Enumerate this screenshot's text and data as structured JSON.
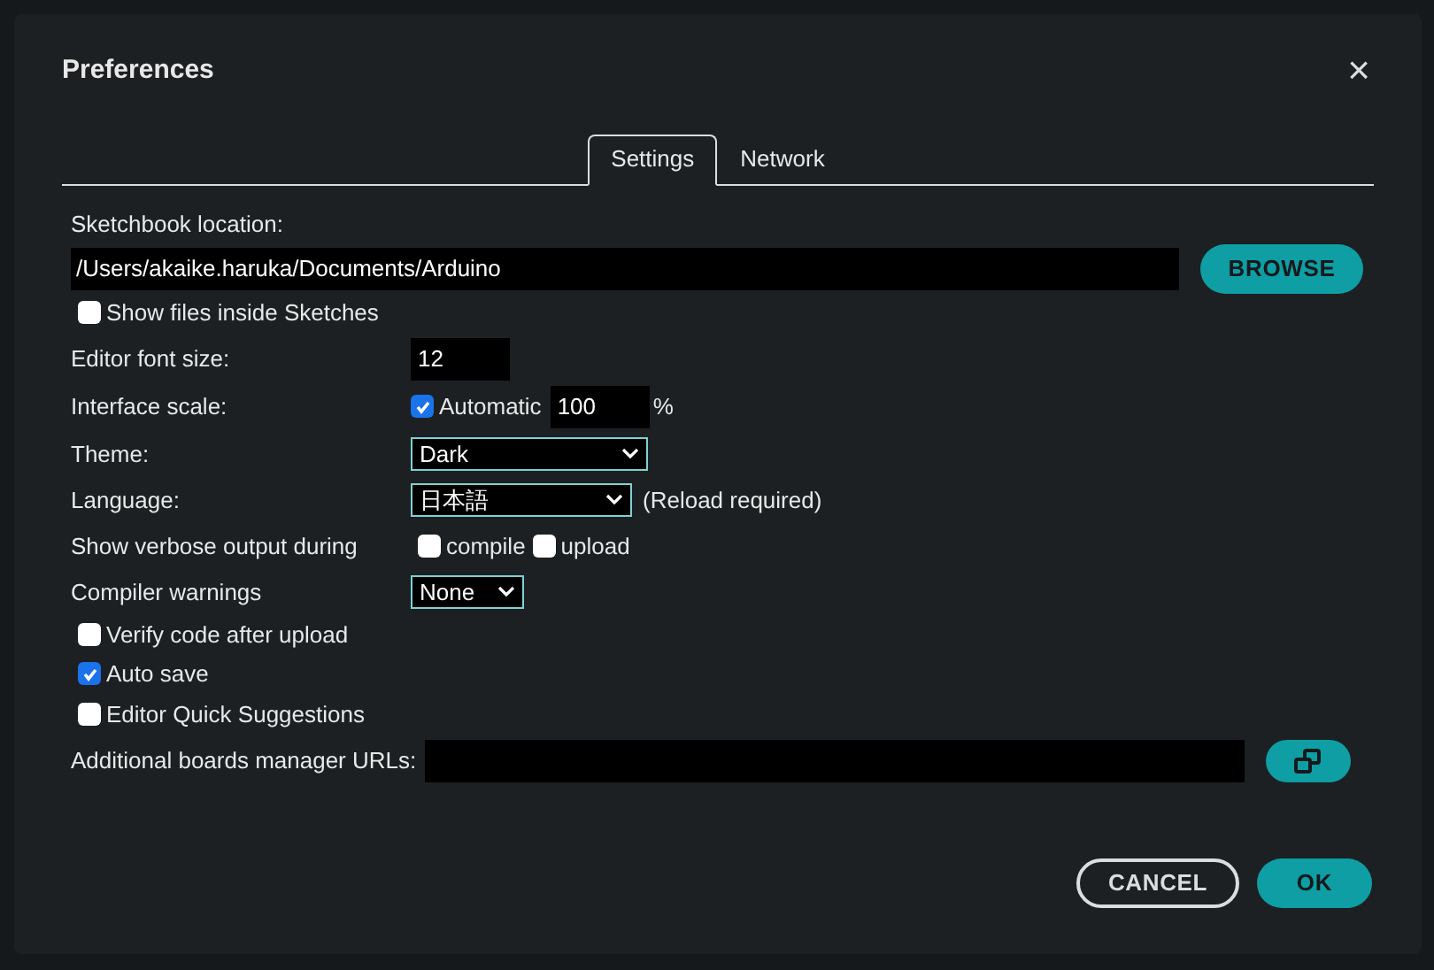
{
  "dialog": {
    "title": "Preferences",
    "close": "×"
  },
  "tabs": [
    {
      "label": "Settings",
      "selected": true
    },
    {
      "label": "Network",
      "selected": false
    }
  ],
  "sketchbook": {
    "label": "Sketchbook location:",
    "value": "/Users/akaike.haruka/Documents/Arduino",
    "browse": "BROWSE",
    "show_files": {
      "label": "Show files inside Sketches",
      "checked": false
    }
  },
  "font_size": {
    "label": "Editor font size:",
    "value": "12"
  },
  "interface_scale": {
    "label": "Interface scale:",
    "automatic": {
      "label": "Automatic",
      "checked": true
    },
    "value": "100",
    "unit": "%"
  },
  "theme": {
    "label": "Theme:",
    "value": "Dark"
  },
  "language": {
    "label": "Language:",
    "value": "日本語",
    "note": "(Reload required)"
  },
  "verbose": {
    "label": "Show verbose output during",
    "options": [
      {
        "label": "compile",
        "checked": false
      },
      {
        "label": "upload",
        "checked": false
      }
    ]
  },
  "compiler_warnings": {
    "label": "Compiler warnings",
    "value": "None"
  },
  "options": [
    {
      "label": "Verify code after upload",
      "checked": false
    },
    {
      "label": "Auto save",
      "checked": true
    },
    {
      "label": "Editor Quick Suggestions",
      "checked": false
    }
  ],
  "boards_urls": {
    "label": "Additional boards manager URLs:"
  },
  "buttons": {
    "cancel": "CANCEL",
    "ok": "OK"
  }
}
